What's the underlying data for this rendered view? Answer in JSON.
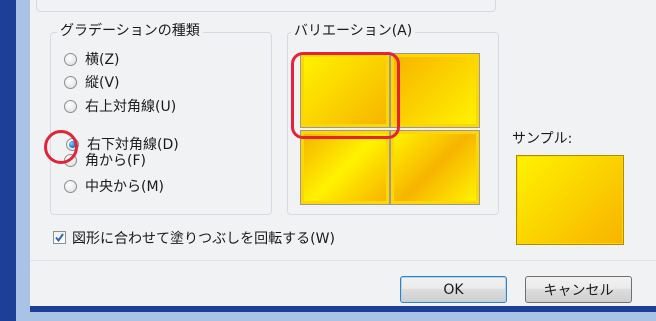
{
  "dialog": {
    "gradient_type_group": {
      "title": "グラデーションの種類",
      "options": [
        {
          "label": "横(Z)",
          "checked": false
        },
        {
          "label": "縦(V)",
          "checked": false
        },
        {
          "label": "右上対角線(U)",
          "checked": false
        },
        {
          "label": "右下対角線(D)",
          "checked": true
        },
        {
          "label": "角から(F)",
          "checked": false
        },
        {
          "label": "中央から(M)",
          "checked": false
        }
      ]
    },
    "variations_group": {
      "title": "バリエーション(A)",
      "selected_index": 0
    },
    "sample_label": "サンプル:",
    "rotate_checkbox": {
      "label": "図形に合わせて塗りつぶしを回転する(W)",
      "checked": true
    },
    "buttons": {
      "ok": "OK",
      "cancel": "キャンセル"
    }
  },
  "colors": {
    "gradient_light": "#fff200",
    "gradient_dark": "#f7b400",
    "highlight": "#e2233a"
  }
}
